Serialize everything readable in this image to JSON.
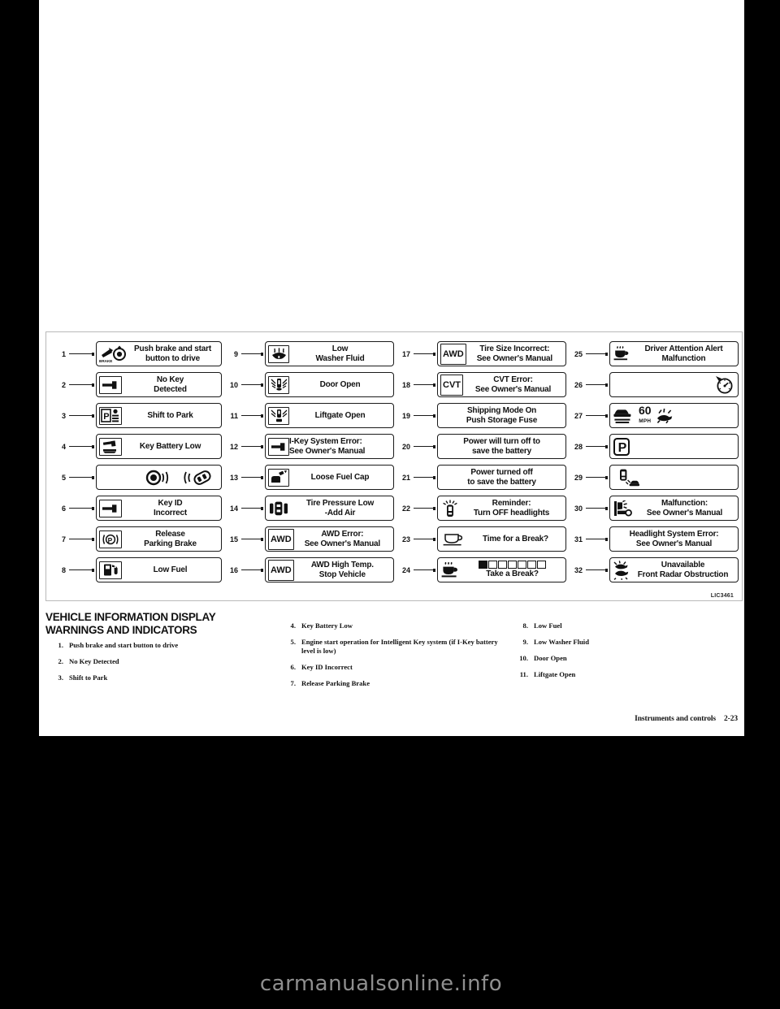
{
  "page": {
    "footer_section": "Instruments and controls",
    "footer_page": "2-23",
    "figure_code": "LIC3461",
    "watermark": "carmanualsonline.info"
  },
  "figure": {
    "columns": [
      {
        "items": [
          {
            "num": "1",
            "icon": "brake-pedal-and-start-button-icon",
            "label": "Push brake and start\nbutton to drive"
          },
          {
            "num": "2",
            "icon": "key-icon",
            "label": "No Key\nDetected"
          },
          {
            "num": "3",
            "icon": "shift-to-park-icon",
            "label": "Shift to Park"
          },
          {
            "num": "4",
            "icon": "key-battery-icon",
            "label": "Key Battery Low"
          },
          {
            "num": "5",
            "icon": "start-button-and-key-fob-icon",
            "label": ""
          },
          {
            "num": "6",
            "icon": "key-icon",
            "label": "Key ID\nIncorrect"
          },
          {
            "num": "7",
            "icon": "parking-brake-icon",
            "label": "Release\nParking Brake"
          },
          {
            "num": "8",
            "icon": "fuel-pump-icon",
            "label": "Low Fuel"
          }
        ]
      },
      {
        "items": [
          {
            "num": "9",
            "icon": "washer-fluid-icon",
            "label": "Low\nWasher Fluid"
          },
          {
            "num": "10",
            "icon": "door-open-icon",
            "label": "Door Open"
          },
          {
            "num": "11",
            "icon": "liftgate-open-icon",
            "label": "Liftgate Open"
          },
          {
            "num": "12",
            "icon": "key-icon",
            "label": "I-Key System Error:\nSee Owner's Manual"
          },
          {
            "num": "13",
            "icon": "fuel-cap-icon",
            "label": "Loose Fuel Cap"
          },
          {
            "num": "14",
            "icon": "tire-pressure-icon",
            "label": "Tire Pressure Low\n-Add Air"
          },
          {
            "num": "15",
            "icon": "awd-box-icon",
            "label": "AWD Error:\nSee Owner's Manual"
          },
          {
            "num": "16",
            "icon": "awd-box-icon",
            "label": "AWD High Temp.\nStop Vehicle"
          }
        ]
      },
      {
        "items": [
          {
            "num": "17",
            "icon": "awd-box-icon",
            "label": "Tire Size Incorrect:\nSee Owner's Manual"
          },
          {
            "num": "18",
            "icon": "cvt-box-icon",
            "label": "CVT Error:\nSee Owner's Manual"
          },
          {
            "num": "19",
            "icon": "none",
            "label": "Shipping Mode On\nPush Storage Fuse"
          },
          {
            "num": "20",
            "icon": "none",
            "label": "Power will turn off to\nsave the battery"
          },
          {
            "num": "21",
            "icon": "none",
            "label": "Power turned off\nto save the battery"
          },
          {
            "num": "22",
            "icon": "headlight-reminder-icon",
            "label": "Reminder:\nTurn OFF headlights"
          },
          {
            "num": "23",
            "icon": "coffee-cup-icon",
            "label": "Time for a Break?"
          },
          {
            "num": "24",
            "icon": "steaming-coffee-icon",
            "label": "Take a Break?"
          }
        ]
      },
      {
        "items": [
          {
            "num": "25",
            "icon": "steaming-coffee-icon",
            "label": "Driver Attention Alert\nMalfunction"
          },
          {
            "num": "26",
            "icon": "speedometer-icon",
            "label": ""
          },
          {
            "num": "27",
            "icon": "speed-limit-60-mph-icon",
            "label": ""
          },
          {
            "num": "28",
            "icon": "park-p-icon",
            "label": ""
          },
          {
            "num": "29",
            "icon": "vehicle-detection-icon",
            "label": ""
          },
          {
            "num": "30",
            "icon": "seat-malfunction-icon",
            "label": "Malfunction:\nSee Owner's Manual"
          },
          {
            "num": "31",
            "icon": "none",
            "label": "Headlight System Error:\nSee Owner's Manual"
          },
          {
            "num": "32",
            "icon": "radar-obstruction-icon",
            "label": "Unavailable\nFront Radar Obstruction"
          }
        ]
      }
    ],
    "speed_value": "60",
    "speed_unit": "MPH"
  },
  "text": {
    "heading": "VEHICLE INFORMATION DISPLAY WARNINGS AND INDICATORS",
    "col1": [
      {
        "n": "1.",
        "t": "Push brake and start button to drive"
      },
      {
        "n": "2.",
        "t": "No Key Detected"
      },
      {
        "n": "3.",
        "t": "Shift to Park"
      }
    ],
    "col2": [
      {
        "n": "4.",
        "t": "Key Battery Low"
      },
      {
        "n": "5.",
        "t": "Engine start operation for Intelligent Key system (if I-Key battery level is low)"
      },
      {
        "n": "6.",
        "t": "Key ID Incorrect"
      },
      {
        "n": "7.",
        "t": "Release Parking Brake"
      }
    ],
    "col3": [
      {
        "n": "8.",
        "t": "Low Fuel"
      },
      {
        "n": "9.",
        "t": "Low Washer Fluid"
      },
      {
        "n": "10.",
        "t": "Door Open"
      },
      {
        "n": "11.",
        "t": "Liftgate Open"
      }
    ]
  }
}
